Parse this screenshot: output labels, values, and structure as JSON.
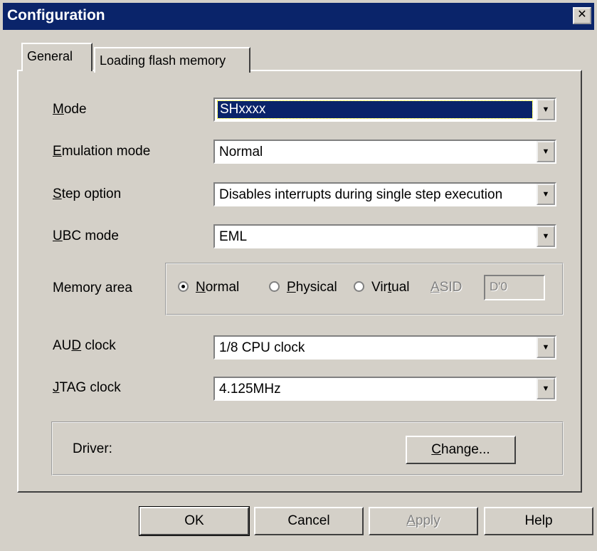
{
  "window": {
    "title": "Configuration",
    "close_glyph": "✕"
  },
  "tabs": [
    {
      "label": "General",
      "active": true
    },
    {
      "label": "Loading flash memory",
      "active": false
    }
  ],
  "fields": {
    "mode": {
      "label": "Mode",
      "value": "SHxxxx"
    },
    "emulation_mode": {
      "label": "Emulation mode",
      "value": "Normal"
    },
    "step_option": {
      "label": "Step option",
      "value": "Disables interrupts during single step execution"
    },
    "ubc_mode": {
      "label": "UBC mode",
      "value": "EML"
    },
    "aud_clock": {
      "label": "AUD clock",
      "value": "1/8 CPU clock"
    },
    "jtag_clock": {
      "label": "JTAG clock",
      "value": "4.125MHz"
    }
  },
  "memory_area": {
    "label": "Memory area",
    "options": [
      {
        "label": "Normal",
        "checked": true
      },
      {
        "label": "Physical",
        "checked": false
      },
      {
        "label": "Virtual",
        "checked": false
      }
    ],
    "asid_label": "ASID",
    "asid_value": "D'0"
  },
  "driver": {
    "label": "Driver:",
    "change_button": "Change..."
  },
  "buttons": {
    "ok": "OK",
    "cancel": "Cancel",
    "apply": "Apply",
    "help": "Help"
  },
  "icons": {
    "combo_arrow": "dropdown-arrow-icon",
    "close": "close-icon"
  }
}
